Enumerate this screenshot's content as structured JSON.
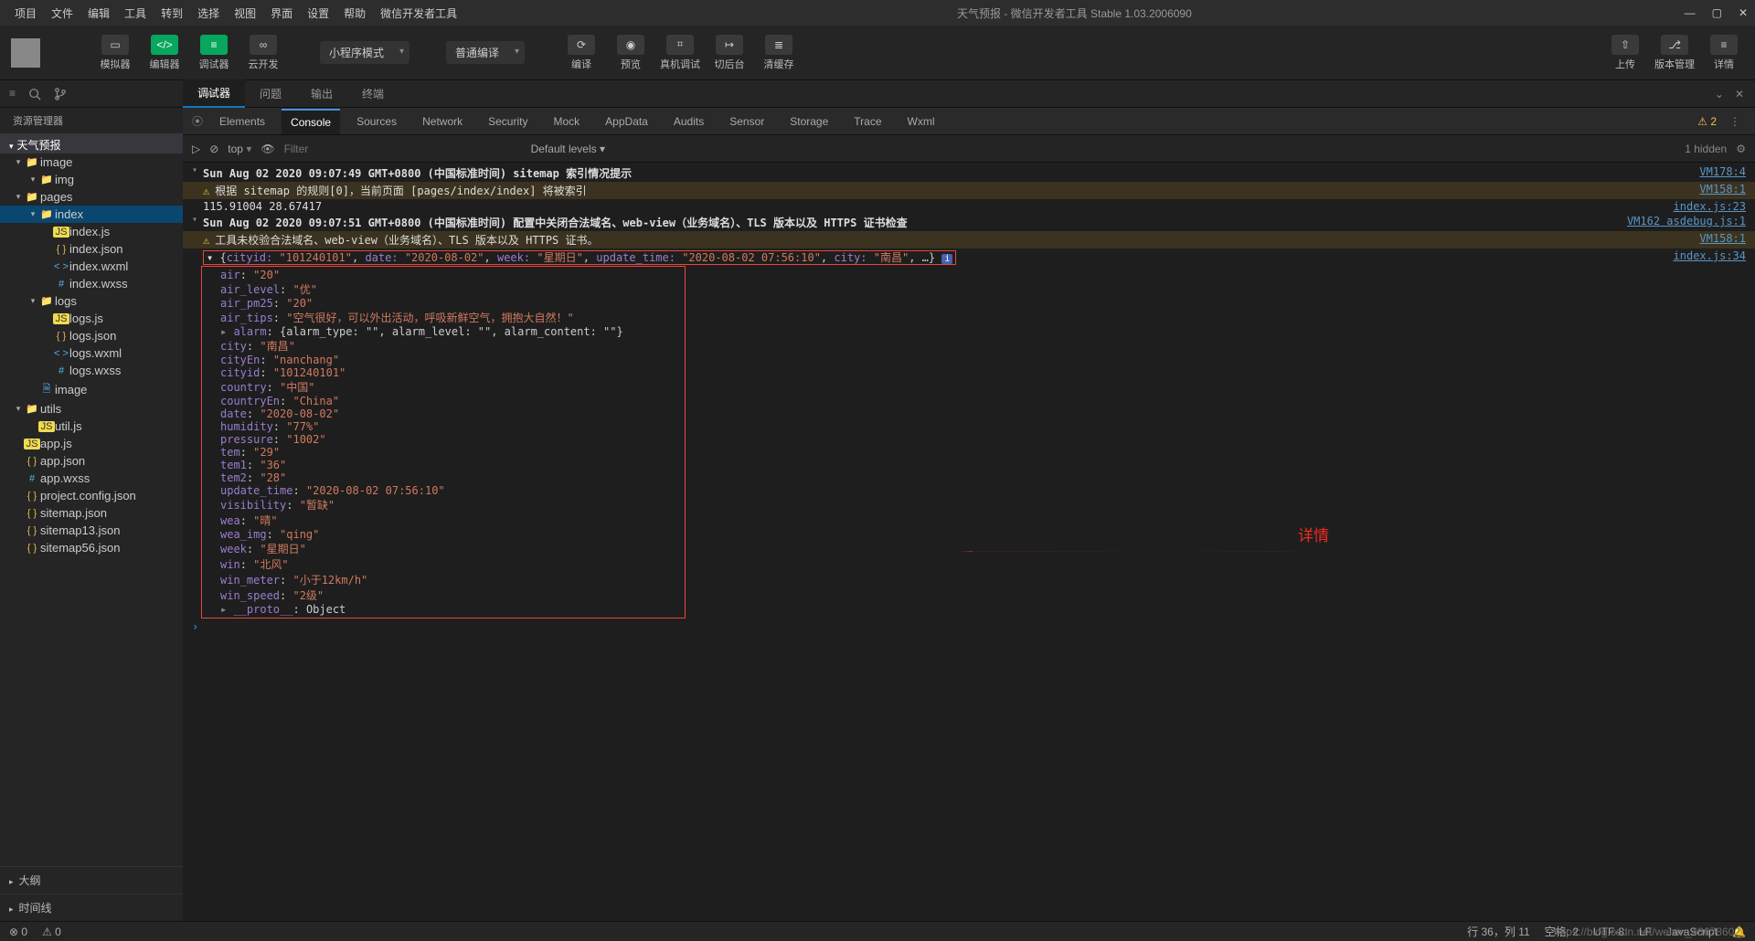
{
  "titlebar": {
    "menus": [
      "项目",
      "文件",
      "编辑",
      "工具",
      "转到",
      "选择",
      "视图",
      "界面",
      "设置",
      "帮助",
      "微信开发者工具"
    ],
    "title": "天气预报 - 微信开发者工具 Stable 1.03.2006090"
  },
  "toolbar": {
    "simulator": "模拟器",
    "editor": "编辑器",
    "debugger": "调试器",
    "cloud": "云开发",
    "modeSelect": "小程序模式",
    "compileSelect": "普通编译",
    "compile": "编译",
    "preview": "预览",
    "realdebug": "真机调试",
    "background": "切后台",
    "clearcache": "清缓存",
    "upload": "上传",
    "version": "版本管理",
    "detail": "详情"
  },
  "secbar": {
    "tabs": [
      "调试器",
      "问题",
      "输出",
      "终端"
    ]
  },
  "sidebar": {
    "title": "资源管理器",
    "project": "天气预报"
  },
  "tree": [
    {
      "d": 0,
      "c": "▾",
      "i": "folder",
      "t": "image"
    },
    {
      "d": 1,
      "c": "▾",
      "i": "folder",
      "t": "img"
    },
    {
      "d": 0,
      "c": "▾",
      "i": "folder2",
      "t": "pages"
    },
    {
      "d": 1,
      "c": "▾",
      "i": "folder2",
      "t": "index",
      "sel": true
    },
    {
      "d": 2,
      "c": "",
      "i": "js",
      "t": "index.js"
    },
    {
      "d": 2,
      "c": "",
      "i": "json",
      "t": "index.json"
    },
    {
      "d": 2,
      "c": "",
      "i": "wxml",
      "t": "index.wxml"
    },
    {
      "d": 2,
      "c": "",
      "i": "wxss",
      "t": "index.wxss"
    },
    {
      "d": 1,
      "c": "▾",
      "i": "folder2",
      "t": "logs"
    },
    {
      "d": 2,
      "c": "",
      "i": "js",
      "t": "logs.js"
    },
    {
      "d": 2,
      "c": "",
      "i": "json",
      "t": "logs.json"
    },
    {
      "d": 2,
      "c": "",
      "i": "wxml",
      "t": "logs.wxml"
    },
    {
      "d": 2,
      "c": "",
      "i": "wxss",
      "t": "logs.wxss"
    },
    {
      "d": 1,
      "c": "",
      "i": "file",
      "t": "image"
    },
    {
      "d": 0,
      "c": "▾",
      "i": "folder2",
      "t": "utils"
    },
    {
      "d": 1,
      "c": "",
      "i": "js",
      "t": "util.js"
    },
    {
      "d": 0,
      "c": "",
      "i": "js",
      "t": "app.js"
    },
    {
      "d": 0,
      "c": "",
      "i": "json",
      "t": "app.json"
    },
    {
      "d": 0,
      "c": "",
      "i": "wxss",
      "t": "app.wxss"
    },
    {
      "d": 0,
      "c": "",
      "i": "json",
      "t": "project.config.json"
    },
    {
      "d": 0,
      "c": "",
      "i": "json",
      "t": "sitemap.json"
    },
    {
      "d": 0,
      "c": "",
      "i": "json",
      "t": "sitemap13.json"
    },
    {
      "d": 0,
      "c": "",
      "i": "json",
      "t": "sitemap56.json"
    }
  ],
  "bottomPanels": [
    "大纲",
    "时间线"
  ],
  "devtools": {
    "tabs": [
      "Elements",
      "Console",
      "Sources",
      "Network",
      "Security",
      "Mock",
      "AppData",
      "Audits",
      "Sensor",
      "Storage",
      "Trace",
      "Wxml"
    ],
    "activeTab": "Console",
    "warnCount": "2",
    "topLabel": "top",
    "filterPlaceholder": "Filter",
    "levelsLabel": "Default levels ▾",
    "hiddenLabel": "1 hidden"
  },
  "console": {
    "line1": {
      "body": "Sun Aug 02 2020 09:07:49 GMT+0800 (中国标准时间) sitemap 索引情况提示",
      "src": "VM178:4"
    },
    "warn1": {
      "body": "根据 sitemap 的规则[0]，当前页面 [pages/index/index] 将被索引",
      "src": "VM158:1"
    },
    "line2": {
      "body": "115.91004 28.67417",
      "src": "index.js:23"
    },
    "line3": {
      "body": "Sun Aug 02 2020 09:07:51 GMT+0800 (中国标准时间) 配置中关闭合法域名、web-view（业务域名）、TLS 版本以及 HTTPS 证书检查",
      "src": "VM162 asdebug.js:1"
    },
    "warn2": {
      "body": "工具未校验合法域名、web-view（业务域名）、TLS 版本以及 HTTPS 证书。",
      "src": "VM158:1"
    },
    "objHeaderSrc": "index.js:34",
    "objSummary": {
      "cityid": "\"101240101\"",
      "date": "\"2020-08-02\"",
      "week": "\"星期日\"",
      "update_time": "\"2020-08-02 07:56:10\"",
      "city": "\"南昌\""
    },
    "obj": [
      {
        "k": "air",
        "v": "\"20\""
      },
      {
        "k": "air_level",
        "v": "\"优\""
      },
      {
        "k": "air_pm25",
        "v": "\"20\""
      },
      {
        "k": "air_tips",
        "v": "\"空气很好，可以外出活动，呼吸新鲜空气，拥抱大自然！\""
      },
      {
        "k": "alarm",
        "raw": "{alarm_type: \"\", alarm_level: \"\", alarm_content: \"\"}",
        "expand": true
      },
      {
        "k": "city",
        "v": "\"南昌\""
      },
      {
        "k": "cityEn",
        "v": "\"nanchang\""
      },
      {
        "k": "cityid",
        "v": "\"101240101\""
      },
      {
        "k": "country",
        "v": "\"中国\""
      },
      {
        "k": "countryEn",
        "v": "\"China\""
      },
      {
        "k": "date",
        "v": "\"2020-08-02\""
      },
      {
        "k": "humidity",
        "v": "\"77%\""
      },
      {
        "k": "pressure",
        "v": "\"1002\""
      },
      {
        "k": "tem",
        "v": "\"29\""
      },
      {
        "k": "tem1",
        "v": "\"36\""
      },
      {
        "k": "tem2",
        "v": "\"28\""
      },
      {
        "k": "update_time",
        "v": "\"2020-08-02 07:56:10\""
      },
      {
        "k": "visibility",
        "v": "\"暂缺\""
      },
      {
        "k": "wea",
        "v": "\"晴\""
      },
      {
        "k": "wea_img",
        "v": "\"qing\""
      },
      {
        "k": "week",
        "v": "\"星期日\""
      },
      {
        "k": "win",
        "v": "\"北风\""
      },
      {
        "k": "win_meter",
        "v": "\"小于12km/h\""
      },
      {
        "k": "win_speed",
        "v": "\"2级\""
      },
      {
        "k": "__proto__",
        "raw": "Object",
        "expand": true
      }
    ]
  },
  "annotation": "详情",
  "status": {
    "errors": "0",
    "warnings": "0",
    "linecol": "行 36，列 11",
    "spaces": "空格: 2",
    "enc": "UTF-8",
    "eol": "LF",
    "lang": "JavaScript"
  },
  "watermark": "https://blog.csdn.net/weixin_48678602"
}
